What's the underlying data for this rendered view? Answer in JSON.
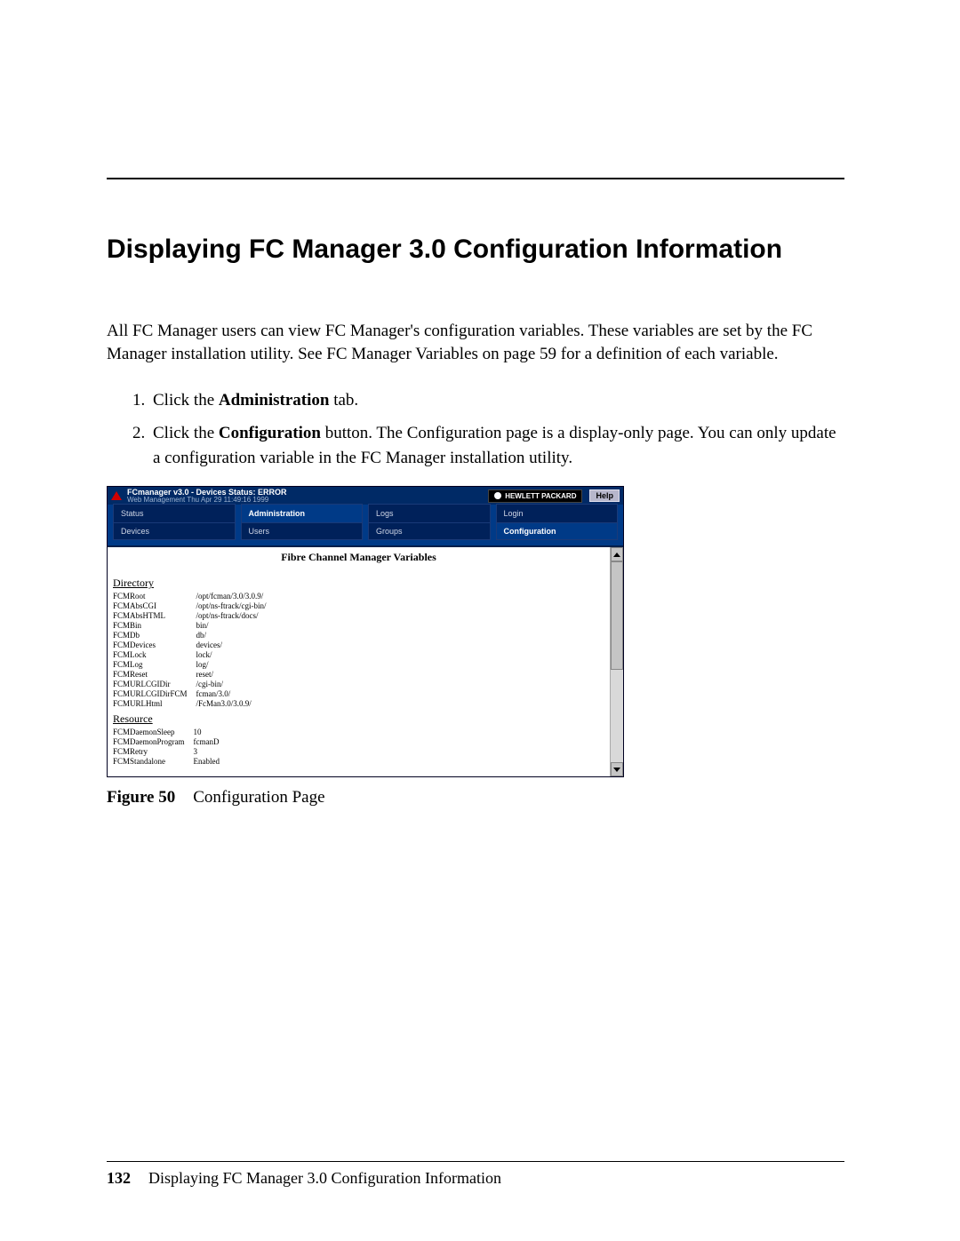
{
  "heading": "Displaying FC Manager 3.0 Configuration Information",
  "intro": "All FC Manager users can view FC Manager's configuration variables. These variables are set by the FC Manager installation utility. See FC Manager Variables on page 59 for a definition of each variable.",
  "steps": {
    "s1_pre": "Click the ",
    "s1_bold": "Administration",
    "s1_post": " tab.",
    "s2_pre": "Click the ",
    "s2_bold": "Configuration",
    "s2_post": " button. The Configuration page is a display-only page. You can only update a configuration variable in the FC Manager installation utility."
  },
  "screenshot": {
    "title_line1": "FCmanager v3.0 - Devices Status: ERROR",
    "title_line2": "Web Management Thu Apr 29 11:49:16 1999",
    "hp_label": "HEWLETT PACKARD",
    "help_label": "Help",
    "tabs": [
      "Status",
      "Administration",
      "Logs",
      "Login"
    ],
    "active_tab": "Administration",
    "subtabs": [
      "Devices",
      "Users",
      "Groups",
      "Configuration"
    ],
    "active_subtab": "Configuration",
    "content_title": "Fibre Channel Manager Variables",
    "groups": [
      {
        "name": "Directory",
        "rows": [
          [
            "FCMRoot",
            "/opt/fcman/3.0/3.0.9/"
          ],
          [
            "FCMAbsCGI",
            "/opt/ns-ftrack/cgi-bin/"
          ],
          [
            "FCMAbsHTML",
            "/opt/ns-ftrack/docs/"
          ],
          [
            "FCMBin",
            "bin/"
          ],
          [
            "FCMDb",
            "db/"
          ],
          [
            "FCMDevices",
            "devices/"
          ],
          [
            "FCMLock",
            "lock/"
          ],
          [
            "FCMLog",
            "log/"
          ],
          [
            "FCMReset",
            "reset/"
          ],
          [
            "FCMURLCGIDir",
            "/cgi-bin/"
          ],
          [
            "FCMURLCGIDirFCM",
            "fcman/3.0/"
          ],
          [
            "FCMURLHtml",
            "/FcMan3.0/3.0.9/"
          ]
        ]
      },
      {
        "name": "Resource",
        "rows": [
          [
            "FCMDaemonSleep",
            "10"
          ],
          [
            "FCMDaemonProgram",
            "fcmanD"
          ],
          [
            "FCMRetry",
            "3"
          ],
          [
            "FCMStandalone",
            "Enabled"
          ]
        ]
      }
    ]
  },
  "figure": {
    "label": "Figure 50",
    "caption": "Configuration Page"
  },
  "footer": {
    "page": "132",
    "text": "Displaying FC Manager 3.0 Configuration Information"
  }
}
